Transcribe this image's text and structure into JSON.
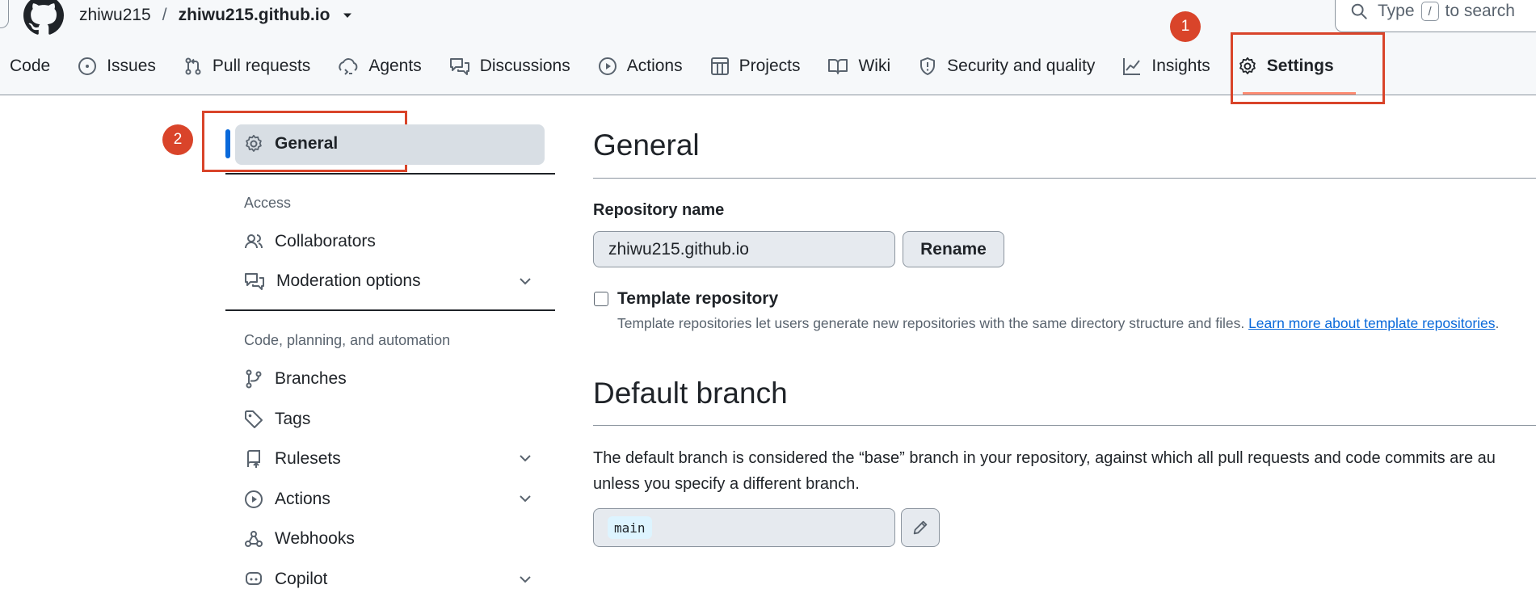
{
  "header": {
    "owner": "zhiwu215",
    "separator": "/",
    "repo": "zhiwu215.github.io",
    "search": {
      "prefix": "Type",
      "key": "/",
      "suffix": "to search"
    }
  },
  "tabs": [
    {
      "label": "Code",
      "icon": "code-icon"
    },
    {
      "label": "Issues",
      "icon": "issue-opened-icon"
    },
    {
      "label": "Pull requests",
      "icon": "git-pull-request-icon"
    },
    {
      "label": "Agents",
      "icon": "agent-icon"
    },
    {
      "label": "Discussions",
      "icon": "comment-discussion-icon"
    },
    {
      "label": "Actions",
      "icon": "play-icon"
    },
    {
      "label": "Projects",
      "icon": "table-icon"
    },
    {
      "label": "Wiki",
      "icon": "book-icon"
    },
    {
      "label": "Security and quality",
      "icon": "shield-icon"
    },
    {
      "label": "Insights",
      "icon": "graph-icon"
    },
    {
      "label": "Settings",
      "icon": "gear-icon",
      "active": true
    }
  ],
  "annotations": {
    "marker1": "1",
    "marker2": "2",
    "color": "#d9442a"
  },
  "sidebar": {
    "general": "General",
    "access_heading": "Access",
    "collaborators": "Collaborators",
    "moderation": "Moderation options",
    "code_heading": "Code, planning, and automation",
    "branches": "Branches",
    "tags": "Tags",
    "rulesets": "Rulesets",
    "actions": "Actions",
    "webhooks": "Webhooks",
    "copilot": "Copilot"
  },
  "main": {
    "title": "General",
    "repo_name_label": "Repository name",
    "repo_name_value": "zhiwu215.github.io",
    "rename_button": "Rename",
    "template_label": "Template repository",
    "template_desc": "Template repositories let users generate new repositories with the same directory structure and files.",
    "template_link": "Learn more about template repositories",
    "template_link_suffix": ".",
    "default_branch_title": "Default branch",
    "default_branch_line1": "The default branch is considered the “base” branch in your repository, against which all pull requests and code commits are au",
    "default_branch_line2": "unless you specify a different branch.",
    "default_branch_value": "main"
  },
  "colors": {
    "accent": "#0969da",
    "active_underline": "#fd8c73",
    "annotation": "#d9442a"
  }
}
